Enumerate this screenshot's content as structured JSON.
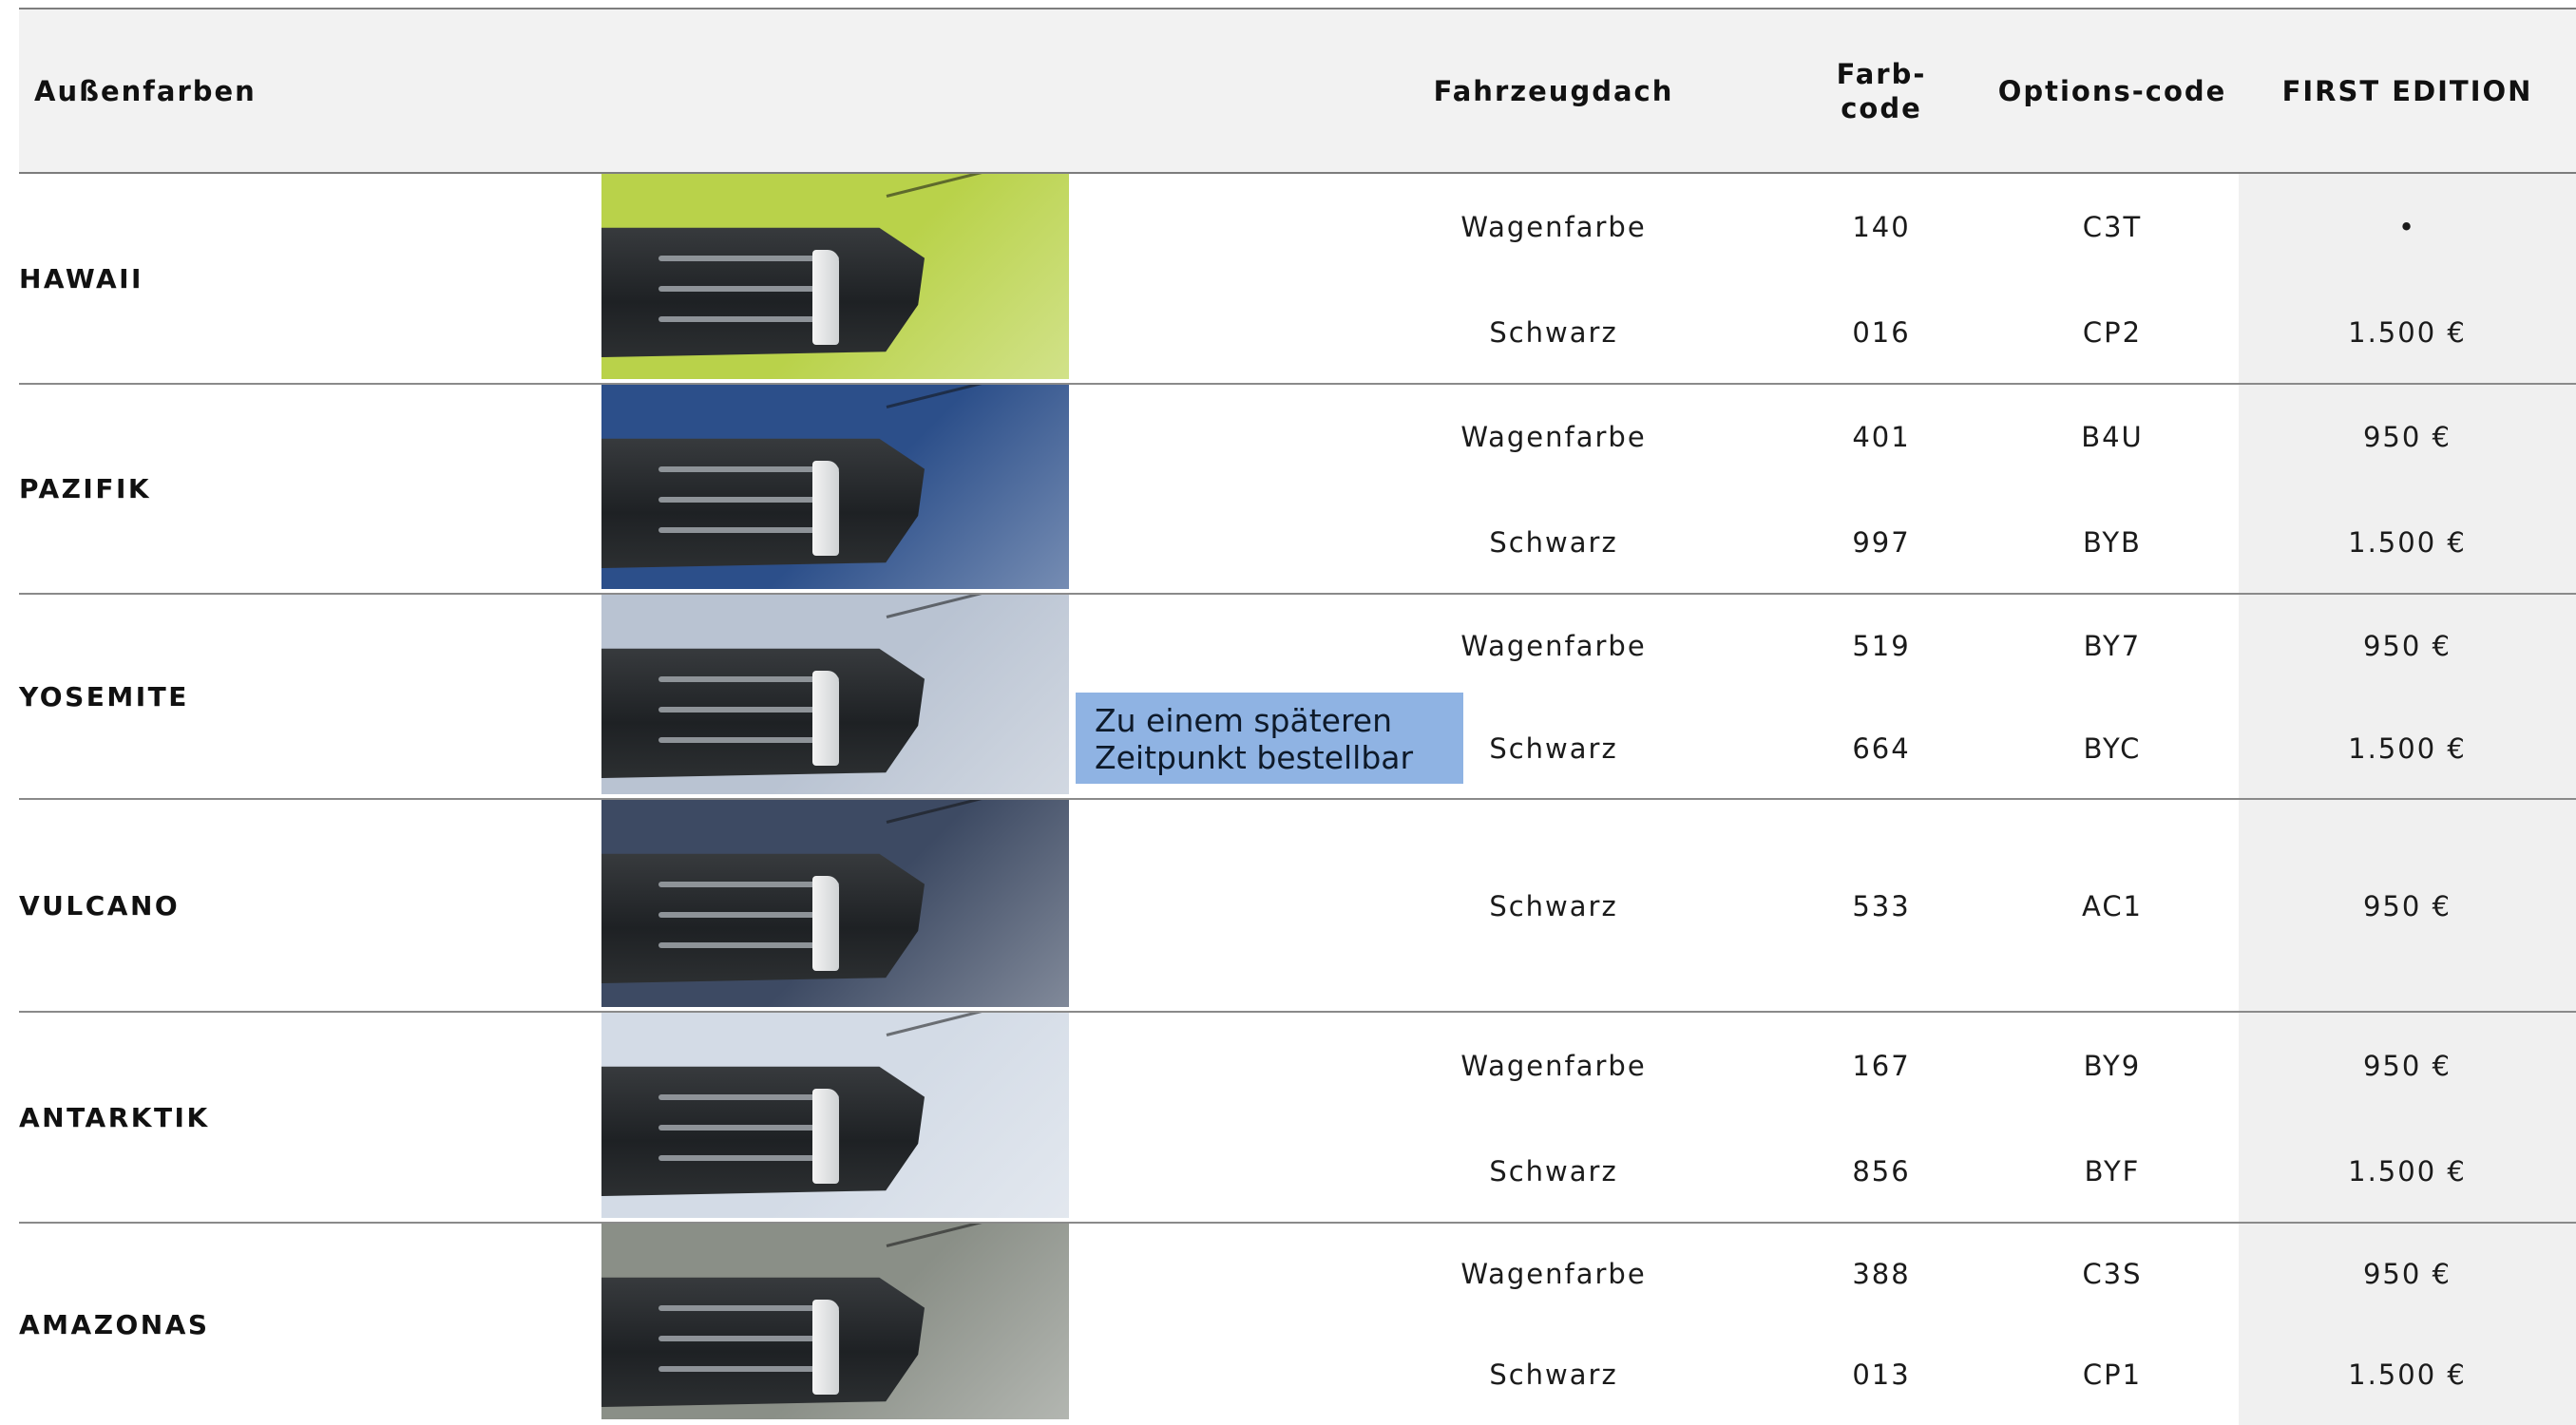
{
  "header": {
    "col_color": "Außenfarben",
    "col_roof": "Fahrzeugdach",
    "col_farbcode": "Farb-\ncode",
    "col_optcode": "Options-code",
    "col_edition": "FIRST EDITION"
  },
  "note": "Zu einem späteren Zeitpunkt bestellbar",
  "colors": [
    {
      "name": "HAWAII",
      "swatch_color": "#b9d24a",
      "rows": [
        {
          "roof": "Wagenfarbe",
          "farbcode": "140",
          "optcode": "C3T",
          "price": "•"
        },
        {
          "roof": "Schwarz",
          "farbcode": "016",
          "optcode": "CP2",
          "price": "1.500 €"
        }
      ]
    },
    {
      "name": "PAZIFIK",
      "swatch_color": "#2c4f8a",
      "rows": [
        {
          "roof": "Wagenfarbe",
          "farbcode": "401",
          "optcode": "B4U",
          "price": "950 €"
        },
        {
          "roof": "Schwarz",
          "farbcode": "997",
          "optcode": "BYB",
          "price": "1.500 €"
        }
      ]
    },
    {
      "name": "YOSEMITE",
      "swatch_color": "#b9c3d2",
      "rows": [
        {
          "roof": "Wagenfarbe",
          "farbcode": "519",
          "optcode": "BY7",
          "price": "950 €"
        },
        {
          "roof": "Schwarz",
          "farbcode": "664",
          "optcode": "BYC",
          "price": "1.500 €"
        }
      ]
    },
    {
      "name": "VULCANO",
      "swatch_color": "#3d4a63",
      "rows": [
        {
          "roof": "Schwarz",
          "farbcode": "533",
          "optcode": "AC1",
          "price": "950 €"
        }
      ]
    },
    {
      "name": "ANTARKTIK",
      "swatch_color": "#d3dbe6",
      "rows": [
        {
          "roof": "Wagenfarbe",
          "farbcode": "167",
          "optcode": "BY9",
          "price": "950 €"
        },
        {
          "roof": "Schwarz",
          "farbcode": "856",
          "optcode": "BYF",
          "price": "1.500 €"
        }
      ]
    },
    {
      "name": "AMAZONAS",
      "swatch_color": "#8a8f87",
      "rows": [
        {
          "roof": "Wagenfarbe",
          "farbcode": "388",
          "optcode": "C3S",
          "price": "950 €"
        },
        {
          "roof": "Schwarz",
          "farbcode": "013",
          "optcode": "CP1",
          "price": "1.500 €"
        }
      ]
    }
  ]
}
